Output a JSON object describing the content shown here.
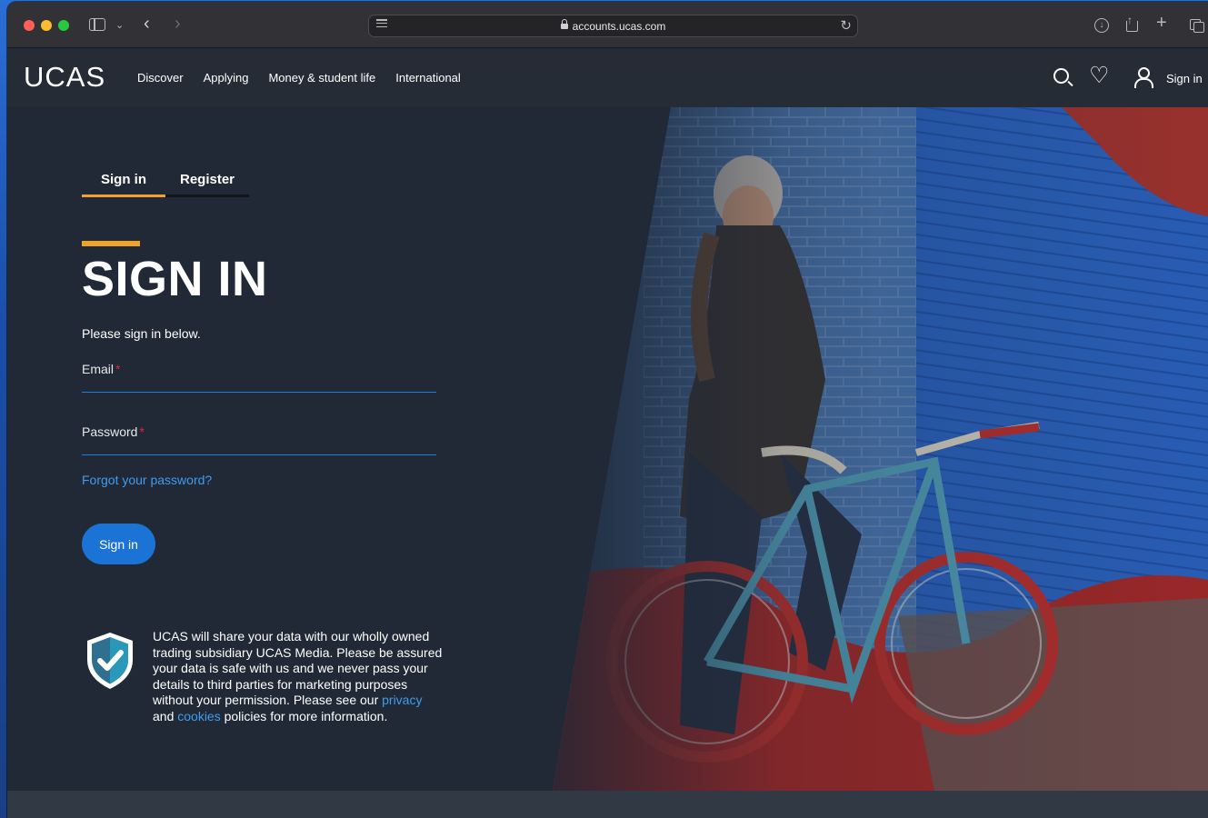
{
  "browser": {
    "url": "accounts.ucas.com"
  },
  "site": {
    "logo": "UCAS",
    "nav": [
      "Discover",
      "Applying",
      "Money & student life",
      "International"
    ],
    "header_signin": "Sign in"
  },
  "auth_tabs": {
    "signin": "Sign in",
    "register": "Register",
    "active": "signin"
  },
  "form": {
    "title": "SIGN IN",
    "intro": "Please sign in below.",
    "email_label": "Email",
    "email_value": "",
    "password_label": "Password",
    "password_value": "",
    "required_marker": "*",
    "forgot_link": "Forgot your password?",
    "submit_label": "Sign in"
  },
  "privacy": {
    "text_before": "UCAS will share your data with our wholly owned trading subsidiary UCAS Media. Please be assured your data is safe with us and we never pass your details to third parties for marketing purposes without your permission. Please see our ",
    "privacy_link": "privacy",
    "text_and": " and ",
    "cookies_link": "cookies",
    "text_after": " policies for more information."
  },
  "colors": {
    "accent": "#f0a328",
    "link": "#3f9cf0",
    "primary_button": "#1a73d5",
    "required": "#d62a36",
    "page_bg": "#212936"
  },
  "icons": {
    "search": "search-icon",
    "favourites": "heart-icon",
    "account": "user-icon",
    "shield": "shield-check-icon"
  }
}
